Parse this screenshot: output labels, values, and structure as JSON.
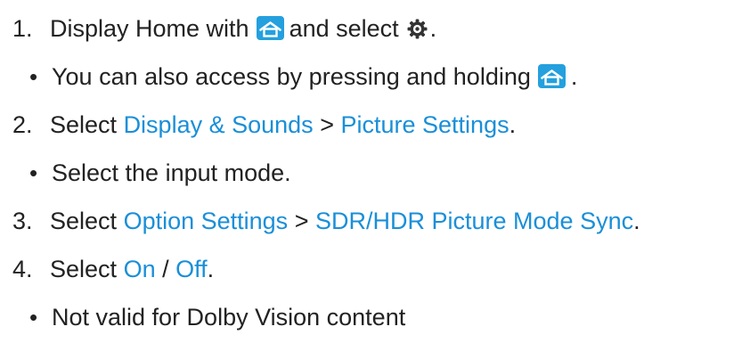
{
  "steps": [
    {
      "number": "1.",
      "text_a": "Display Home with",
      "text_b": "and select",
      "text_c": ".",
      "home_icon": "home-icon",
      "settings_icon": "gear-icon"
    },
    {
      "number": "2.",
      "text_a": "Select",
      "link_a": "Display & Sounds",
      "separator": ">",
      "link_b": "Picture Settings",
      "end": "."
    },
    {
      "number": "3.",
      "text_a": "Select",
      "link_a": "Option Settings",
      "separator": ">",
      "link_b": "SDR/HDR Picture Mode Sync",
      "end": "."
    },
    {
      "number": "4.",
      "text_a": "Select",
      "link_a": "On",
      "separator": "/",
      "link_b": "Off",
      "end": "."
    }
  ],
  "notes": [
    {
      "bullet": "•",
      "text": "You can also access by pressing and holding",
      "icon": "home-icon",
      "end": "."
    },
    {
      "bullet": "•",
      "text": "Select the input mode."
    },
    {
      "bullet": "•",
      "text": "Not valid for Dolby Vision content"
    }
  ],
  "colors": {
    "text": "#222222",
    "link": "#1a8fd8",
    "icon_bg": "#24a0de"
  }
}
